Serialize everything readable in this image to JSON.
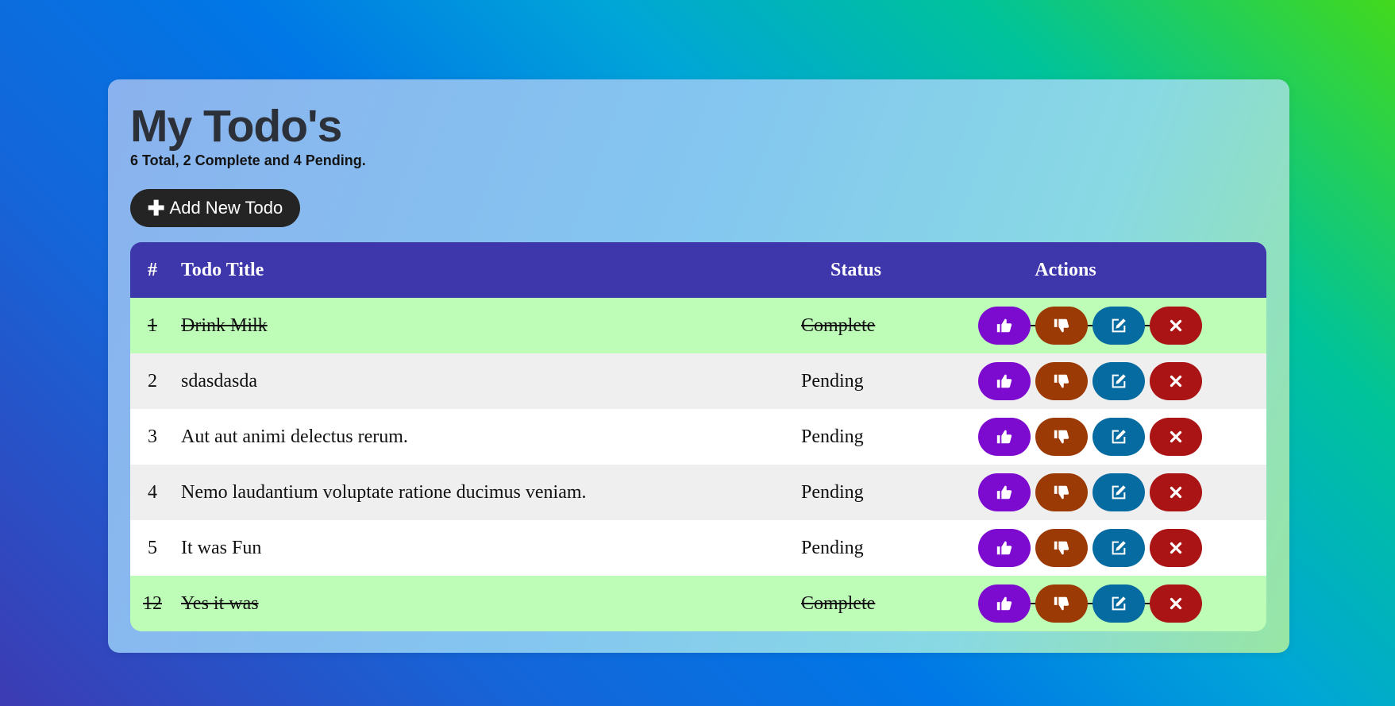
{
  "header": {
    "title": "My Todo's",
    "summary": "6 Total, 2 Complete and 4 Pending."
  },
  "add_button": {
    "label": "Add New Todo",
    "icon": "plus-icon"
  },
  "table": {
    "columns": {
      "num": "#",
      "title": "Todo Title",
      "status": "Status",
      "actions": "Actions"
    },
    "rows": [
      {
        "num": "1",
        "title": "Drink Milk",
        "status": "Complete"
      },
      {
        "num": "2",
        "title": "sdasdasda",
        "status": "Pending"
      },
      {
        "num": "3",
        "title": "Aut aut animi delectus rerum.",
        "status": "Pending"
      },
      {
        "num": "4",
        "title": "Nemo laudantium voluptate ratione ducimus veniam.",
        "status": "Pending"
      },
      {
        "num": "5",
        "title": "It was Fun",
        "status": "Pending"
      },
      {
        "num": "12",
        "title": "Yes it was",
        "status": "Complete"
      }
    ],
    "action_icons": [
      "thumbs-up-icon",
      "thumbs-down-icon",
      "edit-icon",
      "close-icon"
    ]
  },
  "colors": {
    "header_bg": "#3e36ab",
    "complete_row": "#bdfdb7",
    "like": "#7d0bcf",
    "dislike": "#9c3a05",
    "edit": "#066ba0",
    "delete": "#ab1414"
  }
}
